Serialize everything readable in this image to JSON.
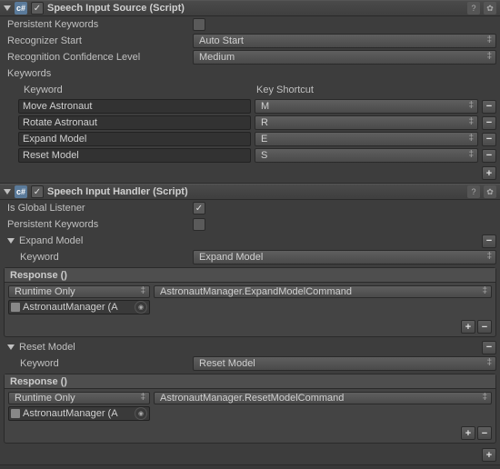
{
  "speechSource": {
    "title": "Speech Input Source (Script)",
    "persistentLabel": "Persistent Keywords",
    "recognizerStartLabel": "Recognizer Start",
    "recognizerStartValue": "Auto Start",
    "confidenceLabel": "Recognition Confidence Level",
    "confidenceValue": "Medium",
    "keywordsLabel": "Keywords",
    "colKeyword": "Keyword",
    "colShortcut": "Key Shortcut",
    "rows": [
      {
        "keyword": "Move Astronaut",
        "shortcut": "M"
      },
      {
        "keyword": "Rotate Astronaut",
        "shortcut": "R"
      },
      {
        "keyword": "Expand Model",
        "shortcut": "E"
      },
      {
        "keyword": "Reset Model",
        "shortcut": "S"
      }
    ]
  },
  "speechHandler": {
    "title": "Speech Input Handler (Script)",
    "globalListenerLabel": "Is Global Listener",
    "persistentLabel": "Persistent Keywords",
    "sections": [
      {
        "name": "Expand Model",
        "keywordLabel": "Keyword",
        "keywordValue": "Expand Model",
        "responseLabel": "Response ()",
        "callState": "Runtime Only",
        "method": "AstronautManager.ExpandModelCommand",
        "target": "AstronautManager (A"
      },
      {
        "name": "Reset Model",
        "keywordLabel": "Keyword",
        "keywordValue": "Reset Model",
        "responseLabel": "Response ()",
        "callState": "Runtime Only",
        "method": "AstronautManager.ResetModelCommand",
        "target": "AstronautManager (A"
      }
    ]
  },
  "glyphs": {
    "check": "✓",
    "plus": "+",
    "minus": "−",
    "gear": "✿",
    "help": "?",
    "dot": "◉"
  }
}
